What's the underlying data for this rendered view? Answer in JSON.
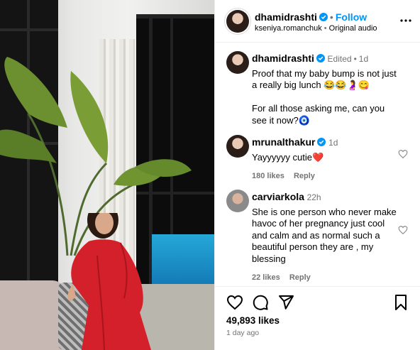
{
  "post": {
    "author": "dhamidrashti",
    "follow_label": "Follow",
    "audio_user": "kseniya.romanchuk",
    "audio_label": "Original audio",
    "separator": "•"
  },
  "caption": {
    "user": "dhamidrashti",
    "edited": "Edited",
    "time": "1d",
    "text": "Proof that my baby bump is not just a really big lunch 😂😂🤰😋\n\nFor all those asking me, can you see it now?🧿"
  },
  "comments": [
    {
      "user": "mrunalthakur",
      "time": "1d",
      "text": "Yayyyyyy cutie❤️",
      "likes": "180 likes",
      "reply": "Reply"
    },
    {
      "user": "carviarkola",
      "time": "22h",
      "text": "She is one person who never make havoc of her pregnancy just cool and calm and as normal such a beautiful person they are , my blessing",
      "likes": "22 likes",
      "reply": "Reply"
    }
  ],
  "footer": {
    "likes": "49,893 likes",
    "time_ago": "1 day ago"
  },
  "icons": {
    "like": "heart-icon",
    "comment": "comment-icon",
    "share": "send-icon",
    "save": "bookmark-icon",
    "more": "more-options-icon",
    "verified": "verified-badge-icon"
  },
  "colors": {
    "link_blue": "#0095f6",
    "verified_blue": "#0095f6",
    "muted_text": "#737373",
    "dress_red": "#d3202a"
  }
}
